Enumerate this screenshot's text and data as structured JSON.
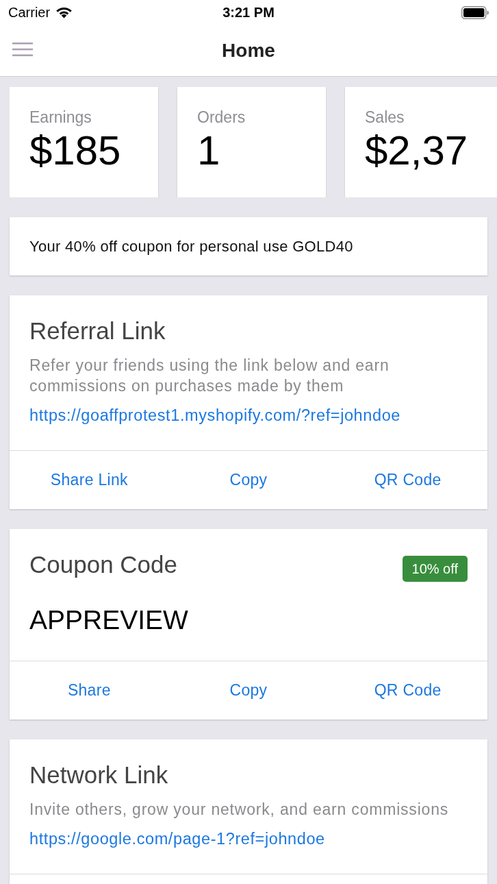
{
  "status_bar": {
    "carrier": "Carrier",
    "time": "3:21 PM"
  },
  "nav_bar": {
    "title": "Home"
  },
  "stats": [
    {
      "label": "Earnings",
      "value": "$185"
    },
    {
      "label": "Orders",
      "value": "1"
    },
    {
      "label": "Sales",
      "value": "$2,37"
    }
  ],
  "coupon_notice": {
    "text": "Your 40% off coupon for personal use GOLD40"
  },
  "cards": [
    {
      "title": "Referral Link",
      "description": "Refer your friends using the link below and earn commissions on purchases made by them",
      "link": "https://goaffprotest1.myshopify.com/?ref=johndoe",
      "actions": [
        "Share Link",
        "Copy",
        "QR Code"
      ]
    },
    {
      "title": "Coupon Code",
      "badge": "10% off",
      "code": "APPREVIEW",
      "actions": [
        "Share",
        "Copy",
        "QR Code"
      ]
    },
    {
      "title": "Network Link",
      "description": "Invite others, grow your network, and earn commissions",
      "link": "https://google.com/page-1?ref=johndoe"
    }
  ]
}
